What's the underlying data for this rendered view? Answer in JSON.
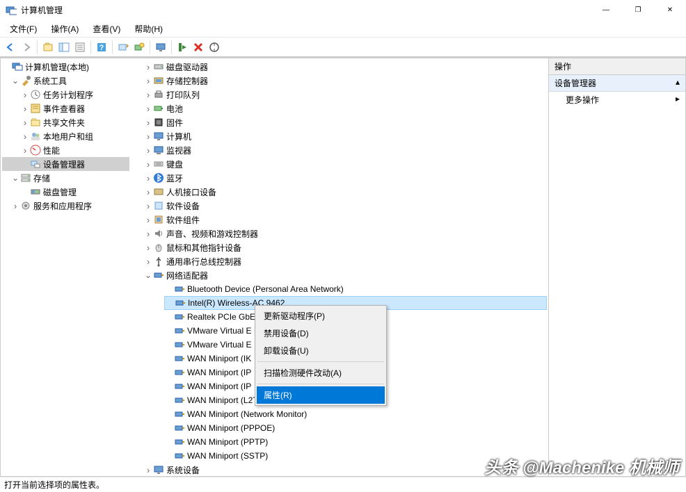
{
  "window": {
    "title": "计算机管理",
    "buttons": {
      "min": "—",
      "max": "❐",
      "close": "✕"
    }
  },
  "menubar": [
    {
      "label": "文件(F)"
    },
    {
      "label": "操作(A)"
    },
    {
      "label": "查看(V)"
    },
    {
      "label": "帮助(H)"
    }
  ],
  "left_tree": {
    "root": "计算机管理(本地)",
    "sys_tools": "系统工具",
    "task_scheduler": "任务计划程序",
    "event_viewer": "事件查看器",
    "shared_folders": "共享文件夹",
    "local_users": "本地用户和组",
    "performance": "性能",
    "device_manager": "设备管理器",
    "storage": "存储",
    "disk_mgmt": "磁盘管理",
    "services": "服务和应用程序"
  },
  "dev_tree": {
    "disk_drives": "磁盘驱动器",
    "storage_ctrl": "存储控制器",
    "print_queues": "打印队列",
    "batteries": "电池",
    "firmware": "固件",
    "computer": "计算机",
    "monitors": "监视器",
    "keyboards": "键盘",
    "bluetooth": "蓝牙",
    "hid": "人机接口设备",
    "software_dev": "软件设备",
    "software_comp": "软件组件",
    "sound": "声音、视频和游戏控制器",
    "mice": "鼠标和其他指针设备",
    "usb": "通用串行总线控制器",
    "network": "网络适配器",
    "net_items": [
      "Bluetooth Device (Personal Area Network)",
      "Intel(R) Wireless-AC 9462",
      "Realtek PCIe GbE",
      "VMware Virtual E",
      "VMware Virtual E",
      "WAN Miniport (IK",
      "WAN Miniport (IP",
      "WAN Miniport (IP",
      "WAN Miniport (L2TP)",
      "WAN Miniport (Network Monitor)",
      "WAN Miniport (PPPOE)",
      "WAN Miniport (PPTP)",
      "WAN Miniport (SSTP)"
    ],
    "system_devices": "系统设备"
  },
  "context_menu": {
    "update": "更新驱动程序(P)",
    "disable": "禁用设备(D)",
    "uninstall": "卸载设备(U)",
    "scan": "扫描检测硬件改动(A)",
    "properties": "属性(R)"
  },
  "right_panel": {
    "header": "操作",
    "section": "设备管理器",
    "more": "更多操作"
  },
  "statusbar": "打开当前选择项的属性表。",
  "watermark": "头条 @Machenike 机械师"
}
